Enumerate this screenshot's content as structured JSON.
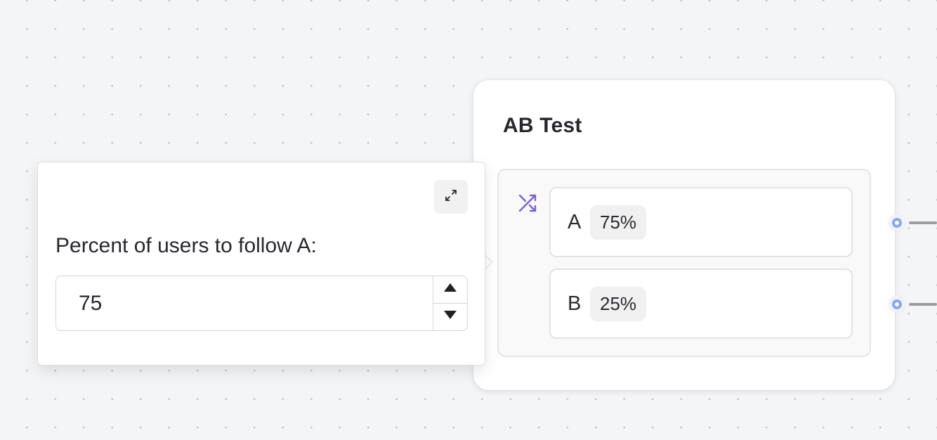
{
  "node": {
    "title": "AB Test",
    "icon": "shuffle-icon",
    "variants": [
      {
        "letter": "A",
        "percent_label": "75%"
      },
      {
        "letter": "B",
        "percent_label": "25%"
      }
    ]
  },
  "editor": {
    "label": "Percent of users to follow A:",
    "value": "75",
    "expand_icon": "expand-icon",
    "increment_icon": "triangle-up-icon",
    "decrement_icon": "triangle-down-icon"
  },
  "colors": {
    "canvas_background": "#f4f5f7",
    "accent_purple": "#7b5fd6",
    "port_blue": "#86a7f3"
  }
}
